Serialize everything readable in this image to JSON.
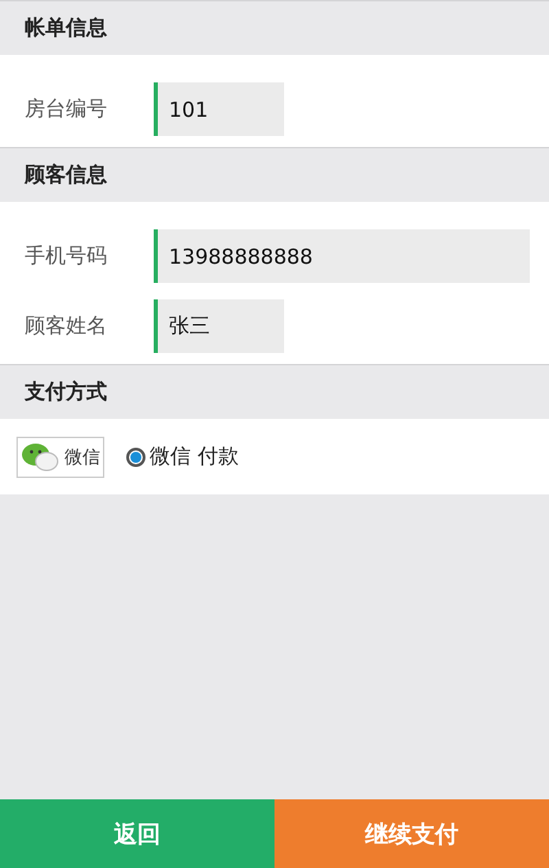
{
  "sections": [
    {
      "title": "帐单信息",
      "fields": [
        {
          "label": "房台编号",
          "value": "101",
          "kind": "short"
        }
      ]
    },
    {
      "title": "顾客信息",
      "fields": [
        {
          "label": "手机号码",
          "value": "13988888888",
          "kind": "long"
        },
        {
          "label": "顾客姓名",
          "value": "张三",
          "kind": "short"
        }
      ]
    }
  ],
  "payment": {
    "title": "支付方式",
    "logo_text": "微信",
    "options": [
      {
        "label": "微信 付款",
        "selected": true
      }
    ]
  },
  "buttons": [
    {
      "label": "返回",
      "kind": "back"
    },
    {
      "label": "继续支付",
      "kind": "primary"
    }
  ]
}
